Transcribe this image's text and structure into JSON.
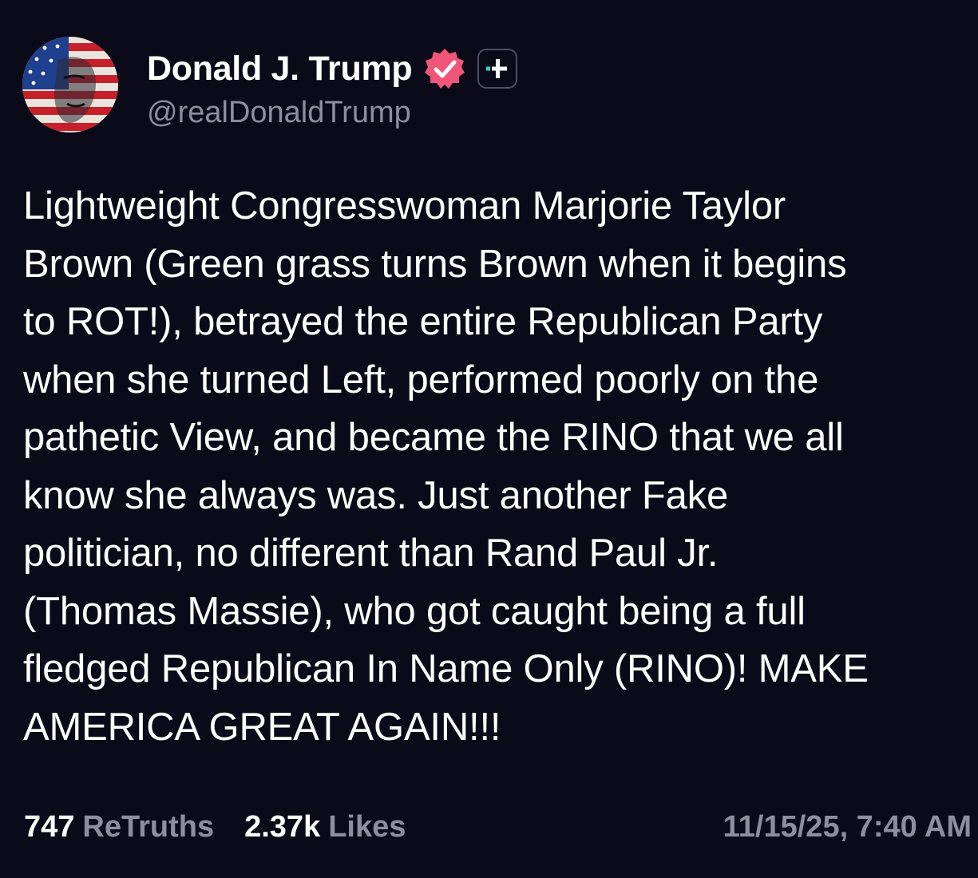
{
  "author": {
    "display_name": "Donald J. Trump",
    "handle": "@realDonaldTrump",
    "avatar_icon": "flag-portrait-avatar",
    "verified_icon": "verified-badge-icon",
    "plus_icon": "plus-badge-icon"
  },
  "post": {
    "lines": [
      "Lightweight Congresswoman Marjorie Taylor",
      "Brown (Green grass turns Brown when it begins",
      "to ROT!), betrayed the entire Republican Party",
      "when she turned Left, performed poorly on the",
      "pathetic View, and became the RINO that we all",
      "know she always was. Just another Fake",
      "politician, no different than Rand Paul Jr.",
      "(Thomas Massie), who got caught being a full",
      "fledged Republican In Name Only (RINO)! MAKE",
      "AMERICA GREAT AGAIN!!!"
    ]
  },
  "stats": {
    "retruths_count": "747",
    "retruths_label": "ReTruths",
    "likes_count": "2.37k",
    "likes_label": "Likes"
  },
  "timestamp": "11/15/25, 7:40 AM",
  "colors": {
    "background": "#0b0a18",
    "primary_text": "#ffffff",
    "secondary_text": "#8e8e9c",
    "verified_badge": "#f0557a"
  }
}
